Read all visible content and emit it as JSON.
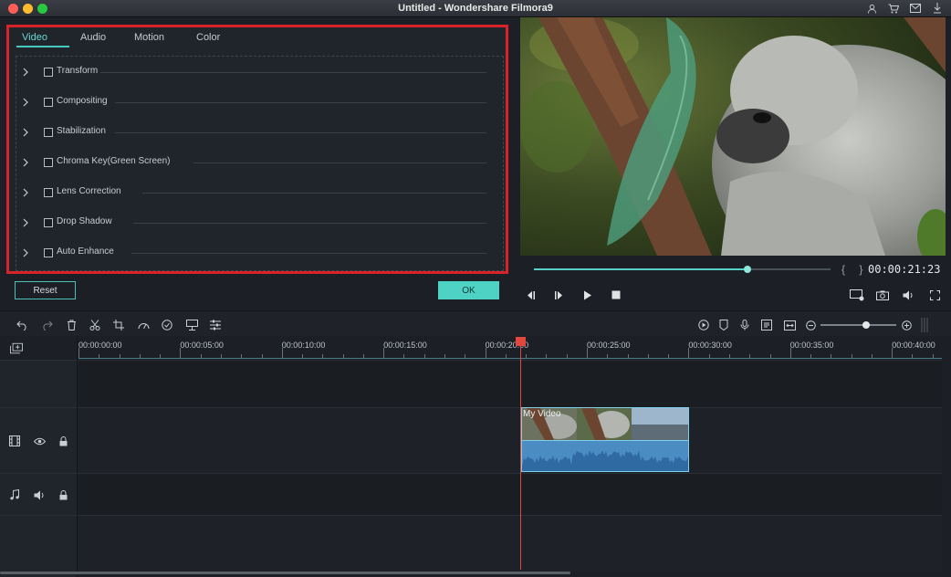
{
  "window": {
    "title": "Untitled - Wondershare Filmora9"
  },
  "titlebar_icons": [
    "account-icon",
    "cart-icon",
    "mail-icon",
    "download-icon"
  ],
  "panel": {
    "tabs": [
      "Video",
      "Audio",
      "Motion",
      "Color"
    ],
    "active_tab": "Video",
    "properties": [
      "Transform",
      "Compositing",
      "Stabilization",
      "Chroma Key(Green Screen)",
      "Lens Correction",
      "Drop Shadow",
      "Auto Enhance"
    ],
    "reset_label": "Reset",
    "ok_label": "OK"
  },
  "preview": {
    "braces": "{ }",
    "timecode": "00:00:21:23",
    "progress": 0.72
  },
  "toolbar": {
    "zoom_level": 0.6
  },
  "timeline": {
    "ruler_labels": [
      "00:00:00:00",
      "00:00:05:00",
      "00:00:10:00",
      "00:00:15:00",
      "00:00:20:00",
      "00:00:25:00",
      "00:00:30:00",
      "00:00:35:00",
      "00:00:40:00"
    ],
    "clip_title": "My Video"
  },
  "colors": {
    "accent": "#4dd2c3",
    "highlight_border": "#d8232a",
    "playhead": "#e2473e",
    "clip": "#4d8fc4"
  }
}
